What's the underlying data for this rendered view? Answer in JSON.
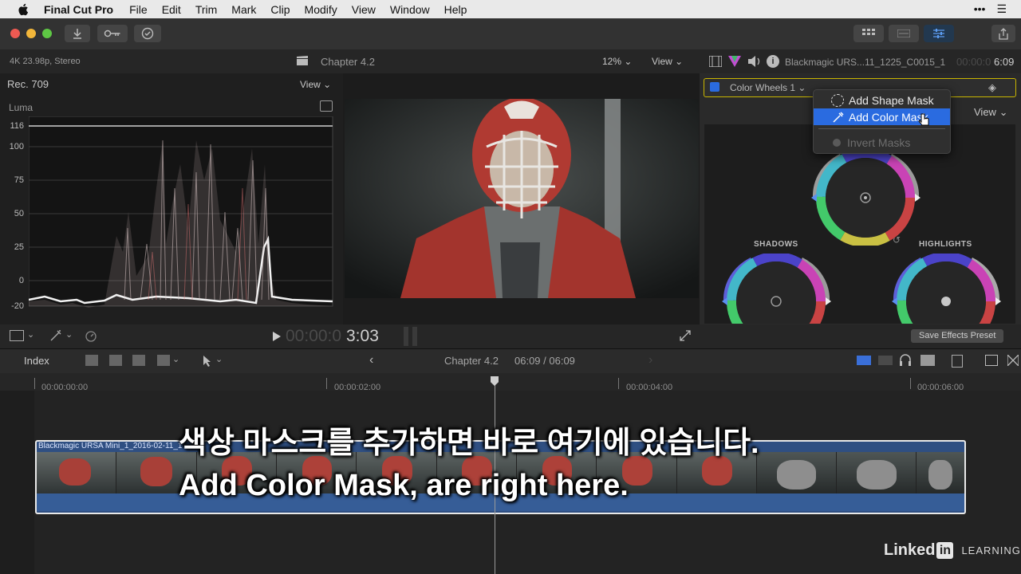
{
  "menubar": {
    "items": [
      "Final Cut Pro",
      "File",
      "Edit",
      "Trim",
      "Mark",
      "Clip",
      "Modify",
      "View",
      "Window",
      "Help"
    ],
    "right": [
      "•••",
      "☰"
    ]
  },
  "scope": {
    "format": "4K 23.98p, Stereo",
    "colorspace": "Rec. 709",
    "view_label": "View",
    "type_label": "Luma",
    "y_labels": [
      "116",
      "100",
      "75",
      "50",
      "25",
      "0",
      "-20"
    ]
  },
  "viewer": {
    "title": "Chapter 4.2",
    "zoom": "12%",
    "view_label": "View",
    "timecode_dim": "00:00:0",
    "timecode": "3:03"
  },
  "inspector": {
    "clip_name": "Blackmagic URS...11_1225_C0015_1",
    "duration_dim": "00:00:0",
    "duration": "6:09",
    "effect_name": "Color Wheels 1",
    "view_label": "View",
    "shadows_label": "SHADOWS",
    "highlights_label": "HIGHLIGHTS",
    "save_preset": "Save Effects Preset"
  },
  "popup": {
    "items": [
      {
        "label": "Add Shape Mask",
        "state": "normal"
      },
      {
        "label": "Add Color Mask",
        "state": "selected"
      },
      {
        "label": "Invert Masks",
        "state": "disabled"
      }
    ]
  },
  "timeline_bar": {
    "index_label": "Index",
    "chapter": "Chapter 4.2",
    "position": "06:09 / 06:09"
  },
  "ruler": [
    "00:00:00:00",
    "00:00:02:00",
    "00:00:04:00",
    "00:00:06:00"
  ],
  "clip": {
    "name": "Blackmagic URSA Mini_1_2016-02-11_1"
  },
  "subtitles": {
    "korean": "색상 마스크를 추가하면 바로 여기에 있습니다.",
    "english": "Add Color Mask, are right here."
  },
  "watermark": {
    "brand": "Linked",
    "in": "in",
    "learning": "LEARNING"
  },
  "colors": {
    "accent_blue": "#2a6be0",
    "clip_blue": "#2f4f82",
    "highlight_yellow": "#c9b600"
  }
}
